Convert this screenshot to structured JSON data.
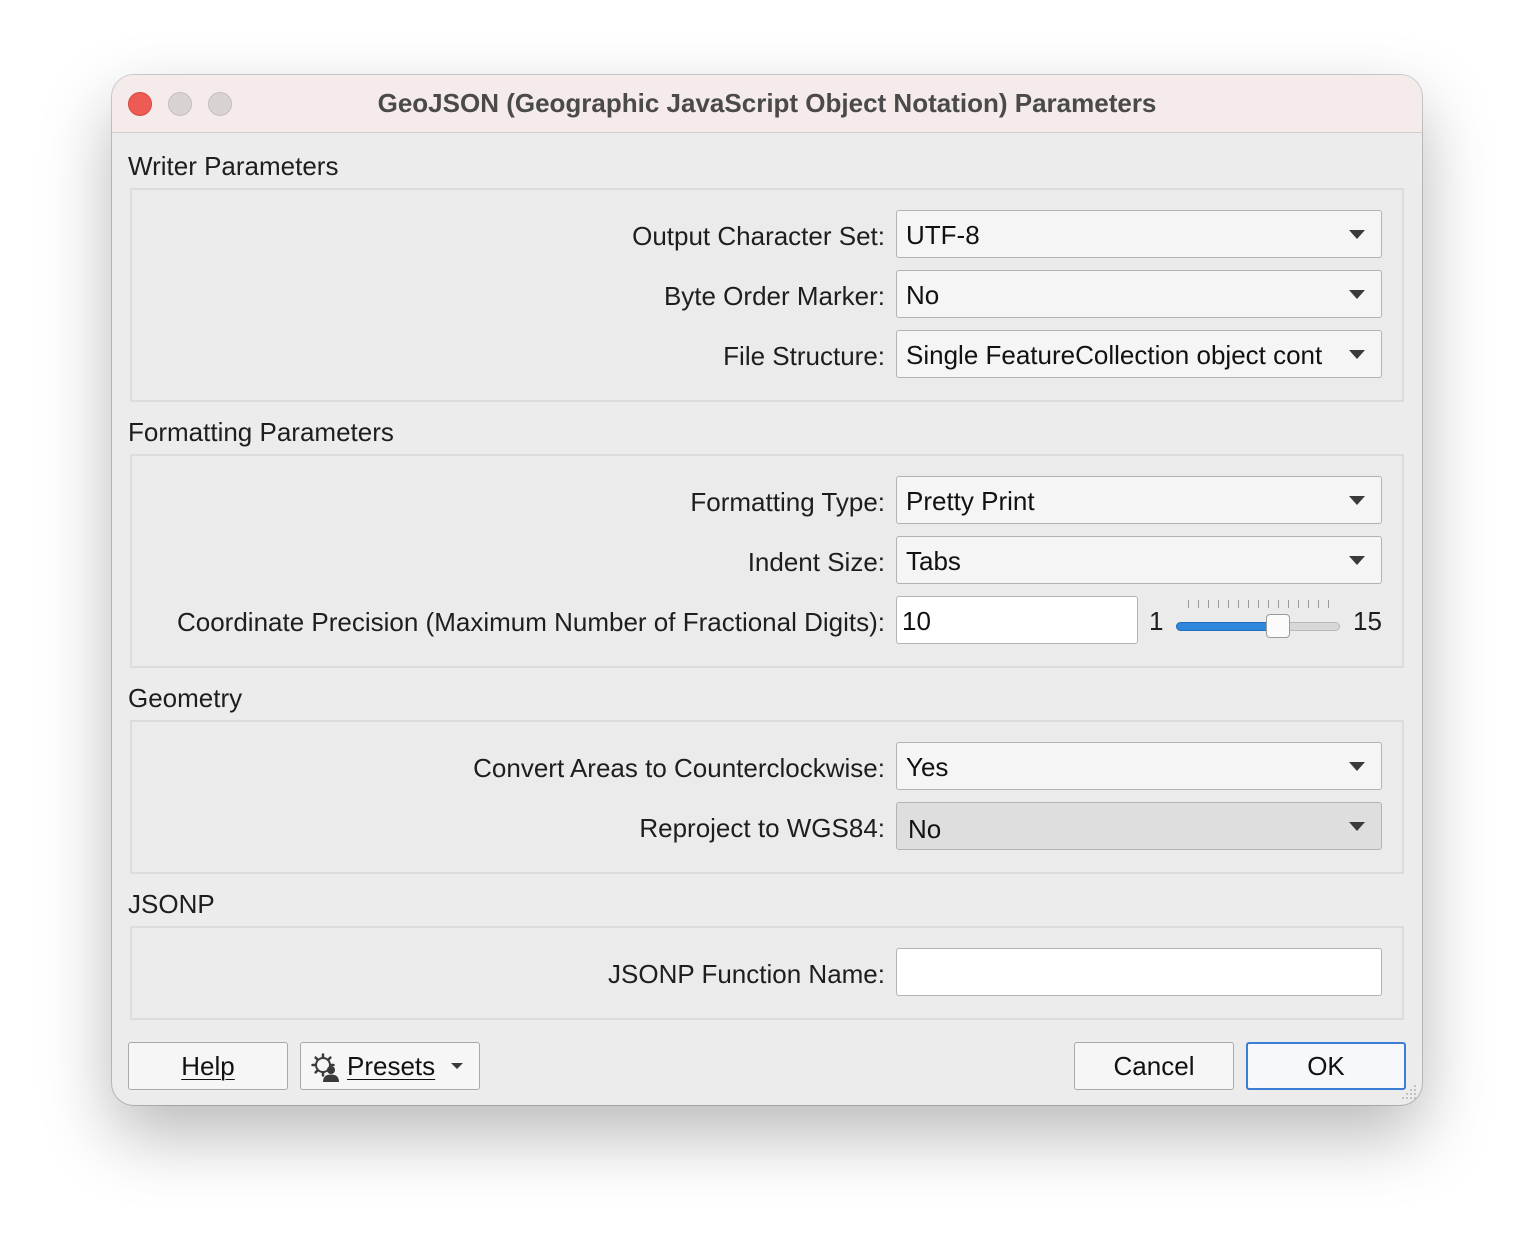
{
  "window": {
    "title": "GeoJSON (Geographic JavaScript Object Notation) Parameters"
  },
  "sections": {
    "writer": {
      "title": "Writer Parameters",
      "output_charset": {
        "label": "Output Character Set:",
        "value": "UTF-8"
      },
      "byte_order": {
        "label": "Byte Order Marker:",
        "value": "No"
      },
      "file_structure": {
        "label": "File Structure:",
        "value": "Single FeatureCollection object cont"
      }
    },
    "formatting": {
      "title": "Formatting Parameters",
      "formatting_type": {
        "label": "Formatting Type:",
        "value": "Pretty Print"
      },
      "indent_size": {
        "label": "Indent Size:",
        "value": "Tabs"
      },
      "precision": {
        "label": "Coordinate Precision (Maximum Number of Fractional Digits):",
        "value": "10",
        "slider_min": "1",
        "slider_max": "15",
        "slider_level": 10
      }
    },
    "geometry": {
      "title": "Geometry",
      "ccw": {
        "label": "Convert Areas to Counterclockwise:",
        "value": "Yes"
      },
      "reproject": {
        "label": "Reproject to WGS84:",
        "value": "No"
      }
    },
    "jsonp": {
      "title": "JSONP",
      "function_name": {
        "label": "JSONP Function Name:",
        "value": ""
      }
    }
  },
  "buttons": {
    "help": "Help",
    "presets": "Presets",
    "cancel": "Cancel",
    "ok": "OK"
  },
  "icons": {
    "presets": "gear-person-icon",
    "dropdown": "triangle-down-icon"
  },
  "colors": {
    "close": "#ee5b55",
    "accent": "#2f86dd",
    "default_button_border": "#3b7fd4"
  }
}
